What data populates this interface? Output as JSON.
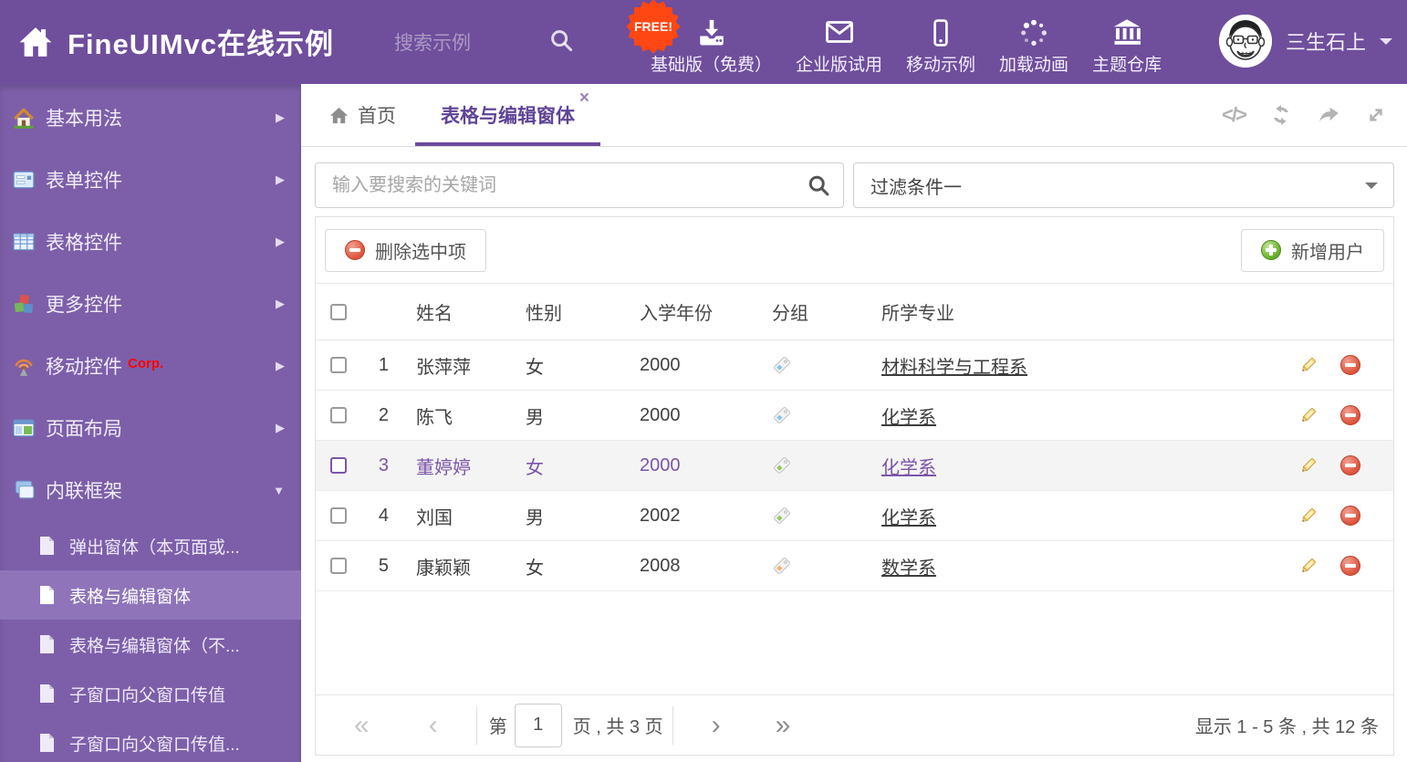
{
  "header": {
    "title": "FineUIMvc在线示例",
    "search_placeholder": "搜索示例",
    "free_badge": "FREE!",
    "nav": [
      {
        "label": "基础版（免费）",
        "icon": "download-icon"
      },
      {
        "label": "企业版试用",
        "icon": "mail-icon"
      },
      {
        "label": "移动示例",
        "icon": "mobile-icon"
      },
      {
        "label": "加载动画",
        "icon": "spinner-icon"
      },
      {
        "label": "主题仓库",
        "icon": "bank-icon"
      }
    ],
    "username": "三生石上"
  },
  "sidebar": {
    "items": [
      {
        "label": "基本用法",
        "icon": "home-icon"
      },
      {
        "label": "表单控件",
        "icon": "form-icon"
      },
      {
        "label": "表格控件",
        "icon": "grid-icon"
      },
      {
        "label": "更多控件",
        "icon": "cubes-icon"
      },
      {
        "label": "移动控件",
        "badge": "Corp.",
        "icon": "antenna-icon"
      },
      {
        "label": "页面布局",
        "icon": "layout-icon"
      },
      {
        "label": "内联框架",
        "icon": "frames-icon",
        "expanded": true
      }
    ],
    "subitems": [
      {
        "label": "弹出窗体（本页面或..."
      },
      {
        "label": "表格与编辑窗体",
        "selected": true
      },
      {
        "label": "表格与编辑窗体（不..."
      },
      {
        "label": "子窗口向父窗口传值"
      },
      {
        "label": "子窗口向父窗口传值..."
      }
    ]
  },
  "tabs": {
    "home": "首页",
    "active": "表格与编辑窗体"
  },
  "filters": {
    "search_placeholder": "输入要搜索的关键词",
    "filter_selected": "过滤条件一"
  },
  "toolbar": {
    "delete_label": "删除选中项",
    "add_label": "新增用户"
  },
  "table": {
    "columns": [
      "姓名",
      "性别",
      "入学年份",
      "分组",
      "所学专业"
    ],
    "rows": [
      {
        "index": 1,
        "name": "张萍萍",
        "gender": "女",
        "year": "2000",
        "tag_color": "#85c4f1",
        "major": "材料科学与工程系",
        "selected": false
      },
      {
        "index": 2,
        "name": "陈飞",
        "gender": "男",
        "year": "2000",
        "tag_color": "#85c4f1",
        "major": "化学系",
        "selected": false
      },
      {
        "index": 3,
        "name": "董婷婷",
        "gender": "女",
        "year": "2000",
        "tag_color": "#93c75c",
        "major": "化学系",
        "selected": true
      },
      {
        "index": 4,
        "name": "刘国",
        "gender": "男",
        "year": "2002",
        "tag_color": "#93c75c",
        "major": "化学系",
        "selected": false
      },
      {
        "index": 5,
        "name": "康颖颖",
        "gender": "女",
        "year": "2008",
        "tag_color": "#f7b069",
        "major": "数学系",
        "selected": false
      }
    ]
  },
  "pagination": {
    "page_prefix": "第",
    "page": "1",
    "page_suffix": "页 , 共 3 页",
    "summary": "显示 1 - 5 条 , 共 12 条"
  },
  "colors": {
    "header_bg": "#6f4e9c",
    "sidebar_bg": "#7d5fa9",
    "sidebar_selected_bg": "#8f74ba",
    "accent": "#6a4a9d",
    "free_badge": "#ff4713",
    "corp_badge": "#ff0000",
    "delete_red": "#dd4936",
    "add_green": "#61a832",
    "selected_row_bg": "#f4f4f4",
    "selected_row_text": "#7b55a9"
  }
}
